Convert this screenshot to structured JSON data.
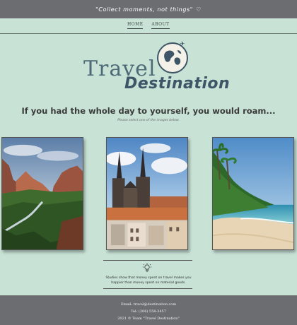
{
  "topbar": {
    "quote": "\"Collect moments, not things\"",
    "heart": "♡"
  },
  "nav": {
    "home": "HOME",
    "about": "ABOUT"
  },
  "logo": {
    "line1": "Travel",
    "line2": "Destination"
  },
  "hero": {
    "headline": "If you had the whole day to yourself, you would roam...",
    "subline": "Please select one of the images below."
  },
  "photos": [
    {
      "name": "canyon"
    },
    {
      "name": "old-town-church"
    },
    {
      "name": "tropical-beach"
    }
  ],
  "fact": {
    "icon": "lightbulb-icon",
    "line1": "Studies show that money spent on travel makes you",
    "line2": "happier than money spent on material goods."
  },
  "footer": {
    "email": "Email: travel@destination.com",
    "tel": "Tel: (206) 558-3457",
    "copyright": "2021 © Team \"Travel Destination\""
  },
  "colors": {
    "background": "#c8e3d6",
    "bars": "#6b6d70",
    "brand": "#3d5566"
  }
}
